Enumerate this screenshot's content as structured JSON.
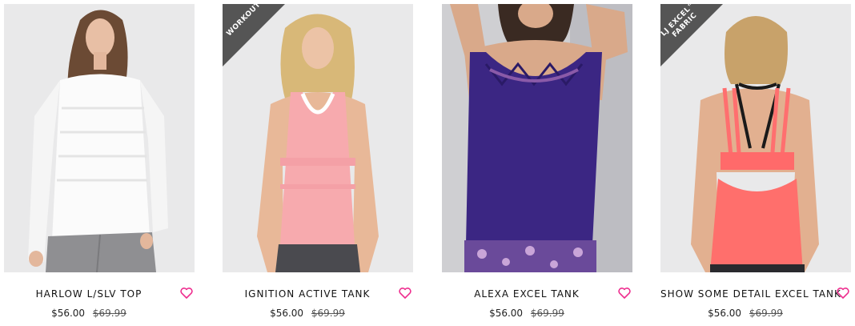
{
  "accent_color": "#ee2d8e",
  "badge_color": "#555555",
  "products": [
    {
      "name": "HARLOW L/SLV TOP",
      "price": "$56.00",
      "old_price": "$69.99",
      "badge": ""
    },
    {
      "name": "IGNITION ACTIVE TANK",
      "price": "$56.00",
      "old_price": "$69.99",
      "badge": "WORKOUT"
    },
    {
      "name": "ALEXA EXCEL TANK",
      "price": "$56.00",
      "old_price": "$69.99",
      "badge": ""
    },
    {
      "name": "SHOW SOME DETAIL EXCEL TANK",
      "price": "$56.00",
      "old_price": "$69.99",
      "badge_line1": "LJ EXCEL™",
      "badge_line2": "FABRIC"
    }
  ],
  "icons": {
    "wishlist": "heart-outline-icon"
  }
}
